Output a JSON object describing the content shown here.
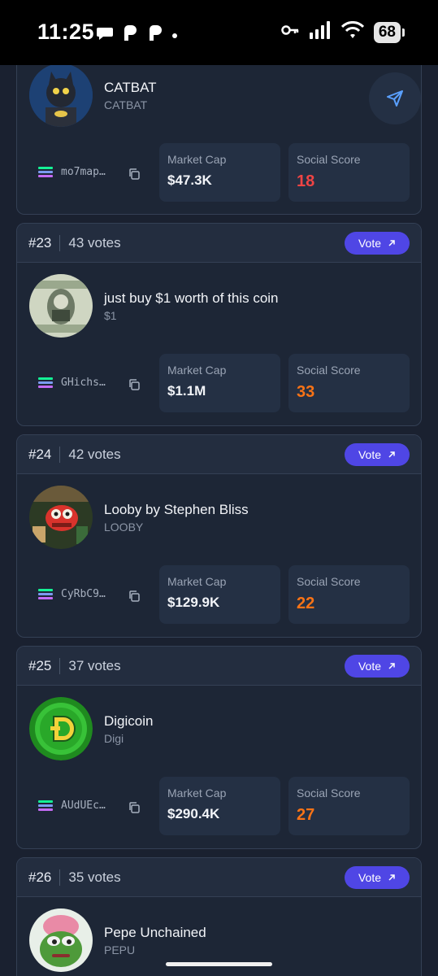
{
  "status_bar": {
    "time": "11:25",
    "battery": "68"
  },
  "vote_label": "Vote",
  "stats_labels": {
    "market_cap": "Market Cap",
    "social_score": "Social Score"
  },
  "colors": {
    "accent": "#4f46e5",
    "score_red": "#ef4444",
    "score_orange": "#f97316",
    "bg": "#1a2130",
    "card": "#1d2636"
  },
  "partial_top_card": {
    "name": "CATBAT",
    "symbol": "CATBAT",
    "address": "mo7map…",
    "market_cap": "$47.3K",
    "social_score": "18",
    "icon": "catbat-avatar"
  },
  "cards": [
    {
      "rank": "#23",
      "votes": "43 votes",
      "name": "just buy $1 worth of this coin",
      "symbol": "$1",
      "address": "GHichs…",
      "market_cap": "$1.1M",
      "social_score": "33",
      "icon": "dollar-bill-avatar"
    },
    {
      "rank": "#24",
      "votes": "42 votes",
      "name": "Looby by Stephen Bliss",
      "symbol": "LOOBY",
      "address": "CyRbC9…",
      "market_cap": "$129.9K",
      "social_score": "22",
      "icon": "looby-avatar"
    },
    {
      "rank": "#25",
      "votes": "37 votes",
      "name": "Digicoin",
      "symbol": "Digi",
      "address": "AUdUEc…",
      "market_cap": "$290.4K",
      "social_score": "27",
      "icon": "digicoin-avatar"
    },
    {
      "rank": "#26",
      "votes": "35 votes",
      "name": "Pepe Unchained",
      "symbol": "PEPU",
      "icon": "pepe-avatar"
    }
  ]
}
